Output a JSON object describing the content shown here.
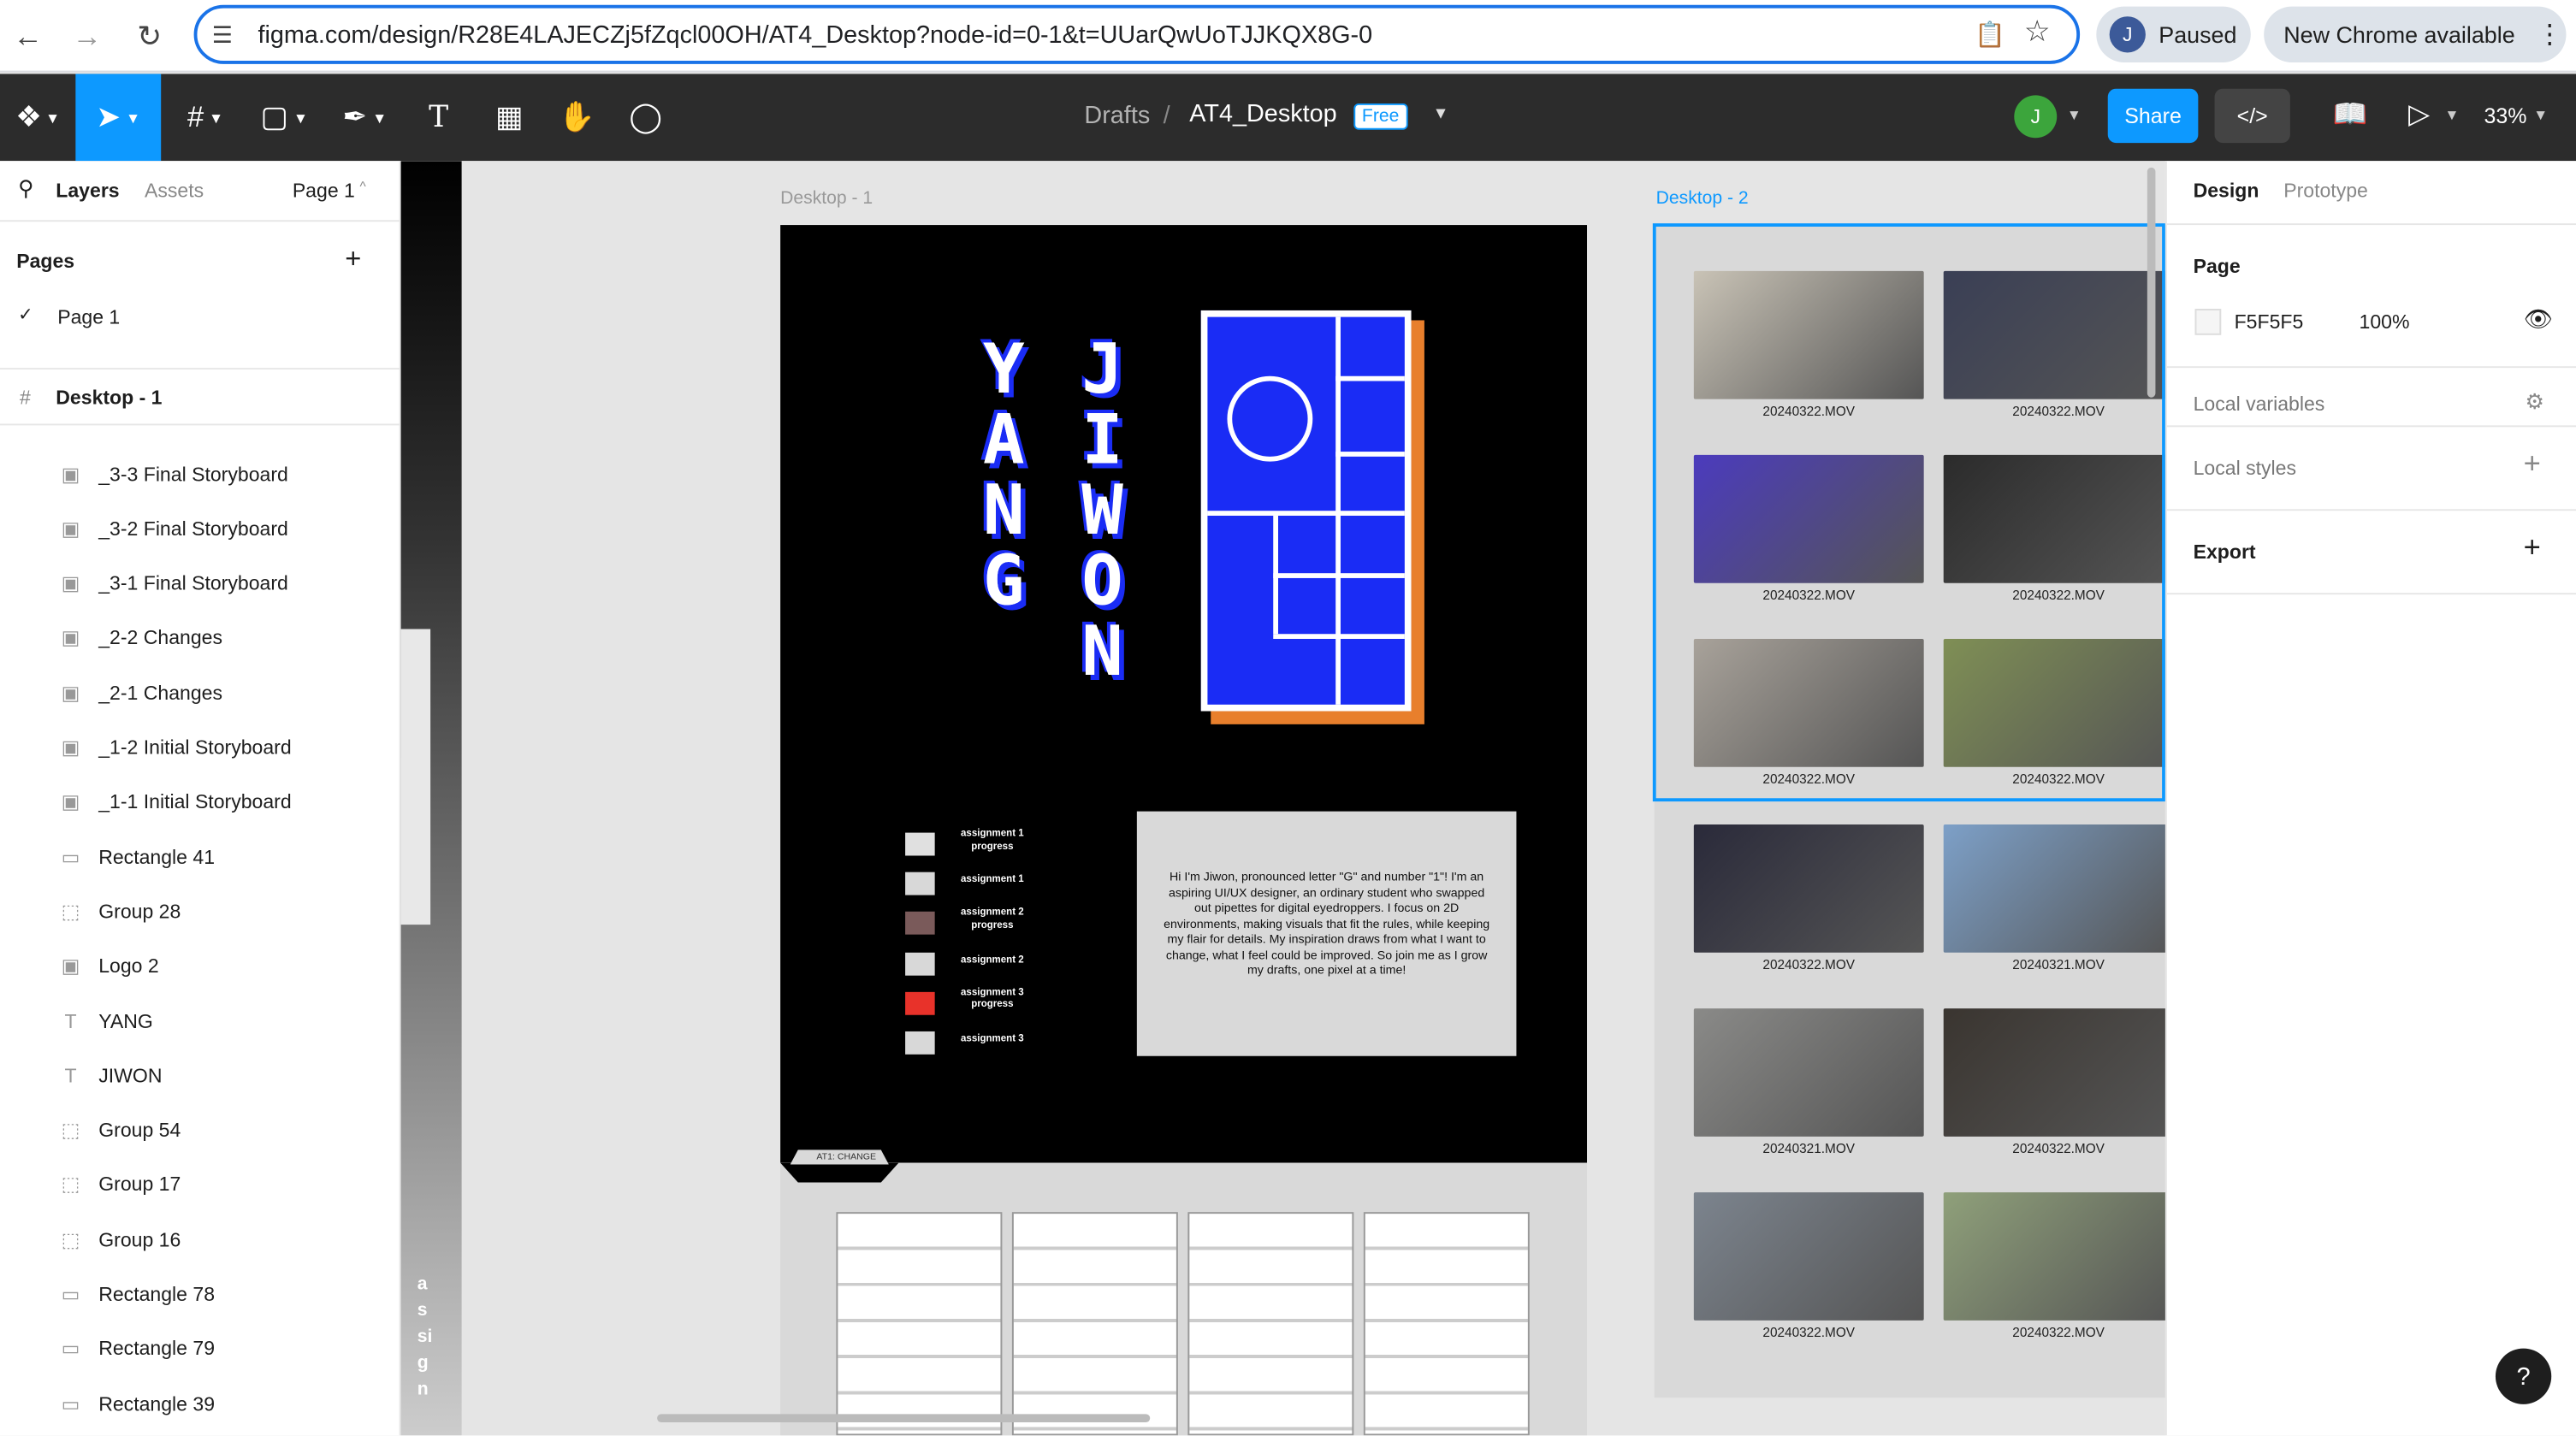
{
  "browser": {
    "url": "figma.com/design/R28E4LAJECZj5fZqcl00OH/AT4_Desktop?node-id=0-1&t=UUarQwUoTJJKQX8G-0",
    "profile_initial": "J",
    "profile_status": "Paused",
    "update_label": "New Chrome available"
  },
  "toolbar": {
    "breadcrumb_root": "Drafts",
    "breadcrumb_sep": "/",
    "file_name": "AT4_Desktop",
    "plan_badge": "Free",
    "user_initial": "J",
    "share_label": "Share",
    "zoom": "33%"
  },
  "left_panel": {
    "tab_layers": "Layers",
    "tab_assets": "Assets",
    "page_selector": "Page 1",
    "pages_heading": "Pages",
    "current_page": "Page 1",
    "frame_name": "Desktop - 1",
    "layers": [
      {
        "name": "_3-3 Final Storyboard",
        "icon": "image-icon"
      },
      {
        "name": "_3-2 Final Storyboard",
        "icon": "image-icon"
      },
      {
        "name": "_3-1 Final Storyboard",
        "icon": "image-icon"
      },
      {
        "name": "_2-2 Changes",
        "icon": "image-icon"
      },
      {
        "name": "_2-1 Changes",
        "icon": "image-icon"
      },
      {
        "name": "_1-2 Initial Storyboard",
        "icon": "image-icon"
      },
      {
        "name": "_1-1 Initial Storyboard",
        "icon": "image-icon"
      },
      {
        "name": "Rectangle 41",
        "icon": "rectangle-icon"
      },
      {
        "name": "Group 28",
        "icon": "group-icon"
      },
      {
        "name": "Logo 2",
        "icon": "image-icon"
      },
      {
        "name": "YANG",
        "icon": "text-icon"
      },
      {
        "name": "JIWON",
        "icon": "text-icon"
      },
      {
        "name": "Group 54",
        "icon": "group-icon"
      },
      {
        "name": "Group 17",
        "icon": "group-icon"
      },
      {
        "name": "Group 16",
        "icon": "group-icon"
      },
      {
        "name": "Rectangle 78",
        "icon": "rectangle-icon"
      },
      {
        "name": "Rectangle 79",
        "icon": "rectangle-icon"
      },
      {
        "name": "Rectangle 39",
        "icon": "rectangle-icon"
      }
    ]
  },
  "canvas": {
    "frame1_label": "Desktop - 1",
    "frame2_label": "Desktop - 2",
    "name_yang": "YANG",
    "name_jiwon": "JIWON",
    "assignments": [
      {
        "label": "assignment 1 progress",
        "color": "#e0e0e0"
      },
      {
        "label": "assignment 1",
        "color": "#d8d8d8"
      },
      {
        "label": "assignment 2 progress",
        "color": "#7a5a5a"
      },
      {
        "label": "assignment 2",
        "color": "#d8d8d8"
      },
      {
        "label": "assignment 3 progress",
        "color": "#e8322a"
      },
      {
        "label": "assignment 3",
        "color": "#d8d8d8"
      }
    ],
    "bio": "Hi I'm Jiwon, pronounced letter \"G\" and number \"1\"! I'm an aspiring UI/UX designer, an ordinary student who swapped out pipettes for digital eyedroppers. I focus on 2D environments, making visuals that fit the rules, while keeping my flair for details. My inspiration draws from what I want to change, what I feel could be improved. So join me as I grow my drafts, one pixel at a time!",
    "tab_label": "AT1: CHANGE",
    "side_text": "assign",
    "videos": [
      {
        "caption": "20240322.MOV",
        "color": "#c9c3b6"
      },
      {
        "caption": "20240322.MOV",
        "color": "#3a3f55"
      },
      {
        "caption": "20240322.MOV",
        "color": "#4b3bbd"
      },
      {
        "caption": "20240322.MOV",
        "color": "#2b2b2b"
      },
      {
        "caption": "20240322.MOV",
        "color": "#a8a29a"
      },
      {
        "caption": "20240322.MOV",
        "color": "#7f8f55"
      },
      {
        "caption": "20240322.MOV",
        "color": "#2a2a3a"
      },
      {
        "caption": "20240321.MOV",
        "color": "#7da0c8"
      },
      {
        "caption": "20240321.MOV",
        "color": "#8a8a88"
      },
      {
        "caption": "20240322.MOV",
        "color": "#3a3530"
      },
      {
        "caption": "20240322.MOV",
        "color": "#7c848e"
      },
      {
        "caption": "20240322.MOV",
        "color": "#8fa07a"
      }
    ]
  },
  "right_panel": {
    "tab_design": "Design",
    "tab_prototype": "Prototype",
    "page_heading": "Page",
    "page_color": "F5F5F5",
    "page_opacity": "100%",
    "local_variables": "Local variables",
    "local_styles": "Local styles",
    "export": "Export",
    "help": "?"
  },
  "colors": {
    "accent": "#0d99ff",
    "figma_blue": "#1a2cf5",
    "toolbar_bg": "#2c2c2c",
    "share_bg": "#0d99ff"
  }
}
